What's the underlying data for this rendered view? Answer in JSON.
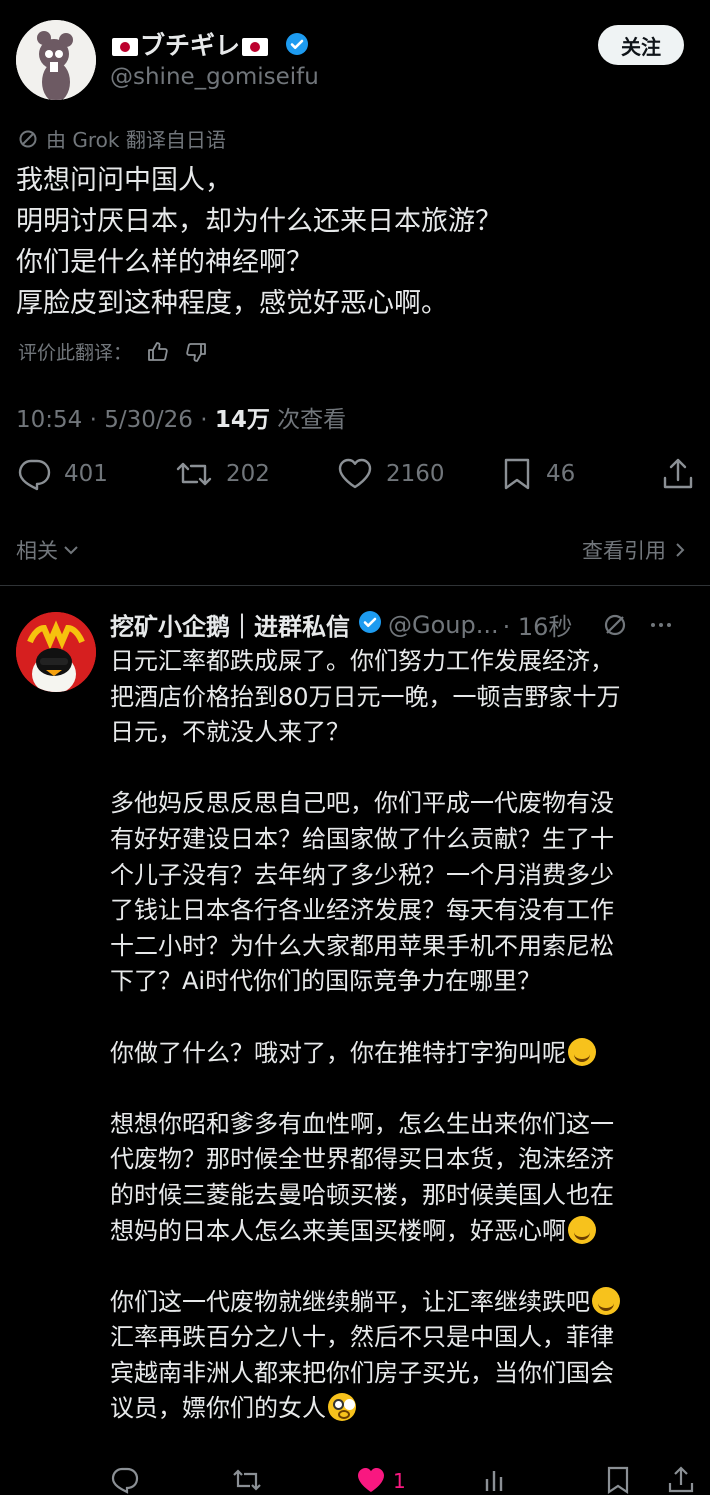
{
  "tweet": {
    "display_name": "ブチギレ",
    "handle": "@shine_gomiseifu",
    "follow_label": "关注",
    "translated_label": "由 Grok 翻译自日语",
    "text_lines": [
      "我想问问中国人，",
      "明明讨厌日本，却为什么还来日本旅游？",
      "你们是什么样的神经啊？",
      "厚脸皮到这种程度，感觉好恶心啊。"
    ],
    "rate_label": "评价此翻译：",
    "time": "10:54 · 5/30/26 · ",
    "views_count": "14万",
    "views_label": " 次查看",
    "stats": {
      "replies": "401",
      "retweets": "202",
      "likes": "2160",
      "bookmarks": "46"
    }
  },
  "related_label": "相关",
  "quotes_label": "查看引用",
  "reply": {
    "name": "挖矿小企鹅｜进群私信",
    "handle": "@Goup...",
    "time": "· 16秒",
    "lines": [
      "日元汇率都跌成屎了。你们努力工作发展经济，",
      "把酒店价格抬到80万日元一晚，一顿吉野家十万",
      "日元，不就没人来了？",
      "",
      "多他妈反思反思自己吧，你们平成一代废物有没",
      "有好好建设日本？给国家做了什么贡献？生了十",
      "个儿子没有？去年纳了多少税？一个月消费多少",
      "了钱让日本各行各业经济发展？每天有没有工作",
      "十二小时？为什么大家都用苹果手机不用索尼松",
      "下了？Ai时代你们的国际竞争力在哪里？",
      "",
      "你做了什么？哦对了，你在推特打字狗叫呢",
      "",
      "想想你昭和爹多有血性啊，怎么生出来你们这一",
      "代废物？那时候全世界都得买日本货，泡沫经济",
      "的时候三菱能去曼哈顿买楼，那时候美国人也在",
      "想妈的日本人怎么来美国买楼啊，好恶心啊",
      "",
      "你们这一代废物就继续躺平，让汇率继续跌吧",
      "汇率再跌百分之八十，然后不只是中国人，菲律",
      "宾越南非洲人都来把你们房子买光，当你们国会",
      "议员，嫖你们的女人"
    ],
    "like_count": "1"
  },
  "colors": {
    "background": "#000000",
    "text": "#e7e9ea",
    "muted": "#71767b",
    "verified": "#1d9bf0",
    "like": "#f91880"
  }
}
